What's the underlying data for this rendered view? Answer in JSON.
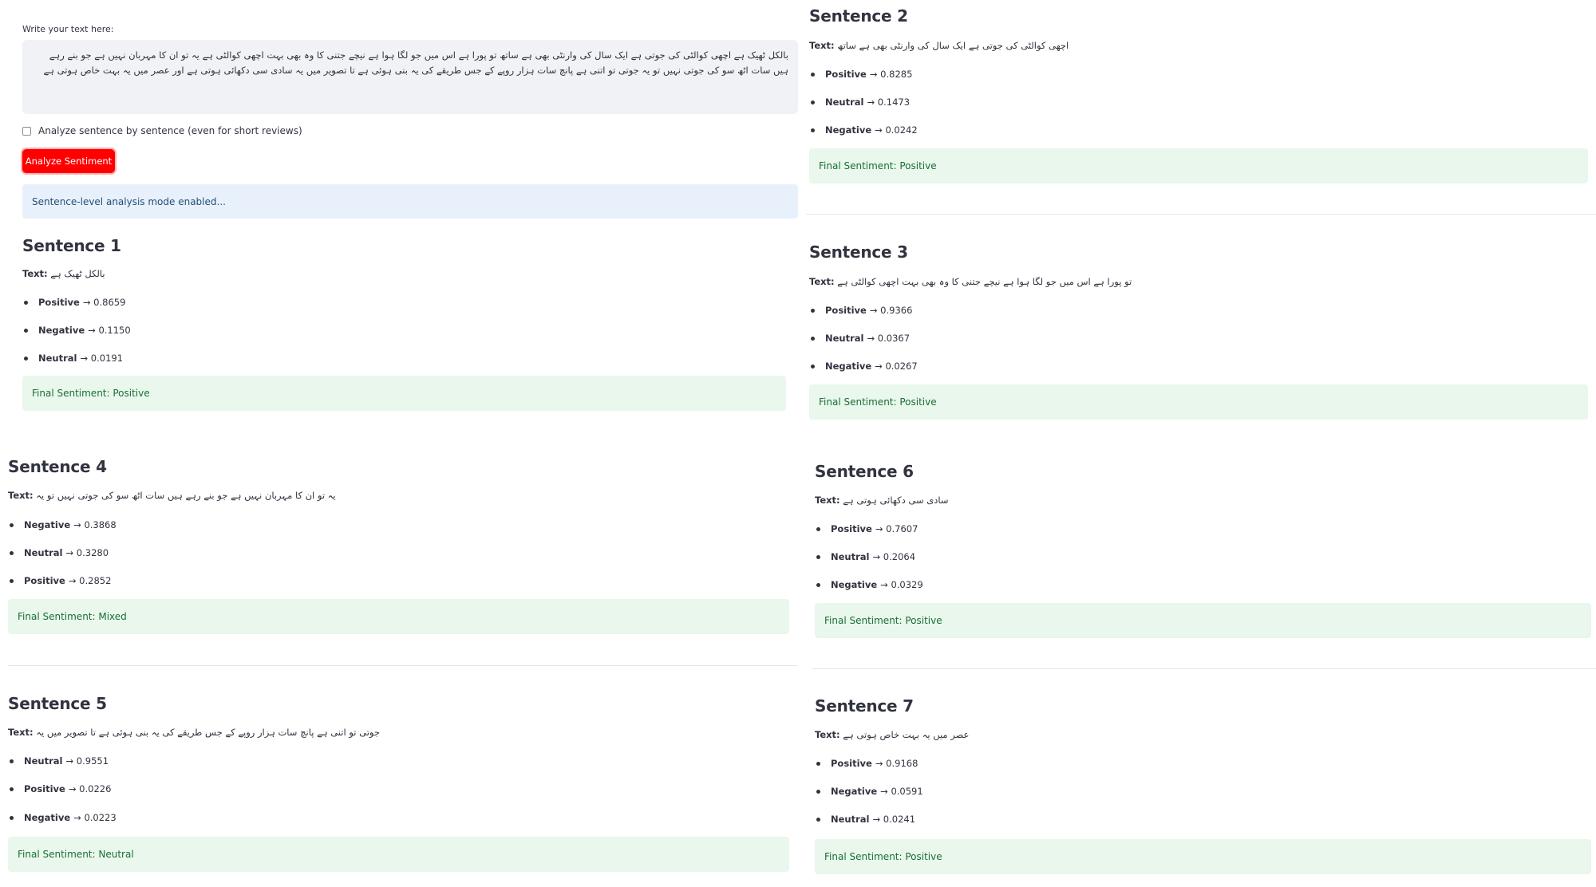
{
  "input": {
    "label": "Write your text here:",
    "value": "بالکل ٹھیک ہے اچھی کوالٹی کی جوتی ہے ایک سال کی وارنٹی بھی ہے ساتھ تو پورا ہے اس میں جو لگا ہوا ہے نیچے جتنی کا وہ بھی بہت اچھی کوالٹی ہے یہ تو ان کا مہربان نہیں ہے جو بنے رہے ہیں سات اٹھ سو کی جوتی نہیں تو یہ جوتی تو اتنی ہے پانچ سات ہزار روپے کے جس طریقے کی یہ بنی ہوئی ہے تا تصویر میں یہ سادی سی دکھائی ہوتی ہے اور عصر میں یہ بہت خاص ہوتی ہے"
  },
  "checkbox": {
    "label": "Analyze sentence by sentence (even for short reviews)"
  },
  "analyze_button": {
    "label": "Analyze Sentiment"
  },
  "info": {
    "text": "Sentence-level analysis mode enabled..."
  },
  "text_prefix": "Text:",
  "sentences": [
    {
      "title": "Sentence 1",
      "text": "بالکل ٹھیک ہے",
      "scores": [
        {
          "label": "Positive",
          "value": "→ 0.8659"
        },
        {
          "label": "Negative",
          "value": "→ 0.1150"
        },
        {
          "label": "Neutral",
          "value": "→ 0.0191"
        }
      ],
      "final": "Final Sentiment: Positive"
    },
    {
      "title": "Sentence 2",
      "text": "اچھی کوالٹی کی جوتی ہے ایک سال کی وارنٹی بھی ہے ساتھ",
      "scores": [
        {
          "label": "Positive",
          "value": "→ 0.8285"
        },
        {
          "label": "Neutral",
          "value": "→ 0.1473"
        },
        {
          "label": "Negative",
          "value": "→ 0.0242"
        }
      ],
      "final": "Final Sentiment: Positive"
    },
    {
      "title": "Sentence 3",
      "text": "تو پورا ہے اس میں جو لگا ہوا ہے نیچے جتنی کا وہ بھی بہت اچھی کوالٹی ہے",
      "scores": [
        {
          "label": "Positive",
          "value": "→ 0.9366"
        },
        {
          "label": "Neutral",
          "value": "→ 0.0367"
        },
        {
          "label": "Negative",
          "value": "→ 0.0267"
        }
      ],
      "final": "Final Sentiment: Positive"
    },
    {
      "title": "Sentence 4",
      "text": "یہ تو ان کا مہربان نہیں ہے جو بنے رہے ہیں سات اٹھ سو کی جوتی نہیں تو یہ",
      "scores": [
        {
          "label": "Negative",
          "value": "→ 0.3868"
        },
        {
          "label": "Neutral",
          "value": "→ 0.3280"
        },
        {
          "label": "Positive",
          "value": "→ 0.2852"
        }
      ],
      "final": "Final Sentiment: Mixed"
    },
    {
      "title": "Sentence 5",
      "text": "جوتی تو اتنی ہے پانچ سات ہزار روپے کے جس طریقے کی یہ بنی ہوئی ہے تا تصویر میں یہ",
      "scores": [
        {
          "label": "Neutral",
          "value": "→ 0.9551"
        },
        {
          "label": "Positive",
          "value": "→ 0.0226"
        },
        {
          "label": "Negative",
          "value": "→ 0.0223"
        }
      ],
      "final": "Final Sentiment: Neutral"
    },
    {
      "title": "Sentence 6",
      "text": "سادی سی دکھائی ہوتی ہے",
      "scores": [
        {
          "label": "Positive",
          "value": "→ 0.7607"
        },
        {
          "label": "Neutral",
          "value": "→ 0.2064"
        },
        {
          "label": "Negative",
          "value": "→ 0.0329"
        }
      ],
      "final": "Final Sentiment: Positive"
    },
    {
      "title": "Sentence 7",
      "text": "عصر میں یہ بہت خاص ہوتی ہے",
      "scores": [
        {
          "label": "Positive",
          "value": "→ 0.9168"
        },
        {
          "label": "Negative",
          "value": "→ 0.0591"
        },
        {
          "label": "Neutral",
          "value": "→ 0.0241"
        }
      ],
      "final": "Final Sentiment: Positive"
    }
  ]
}
